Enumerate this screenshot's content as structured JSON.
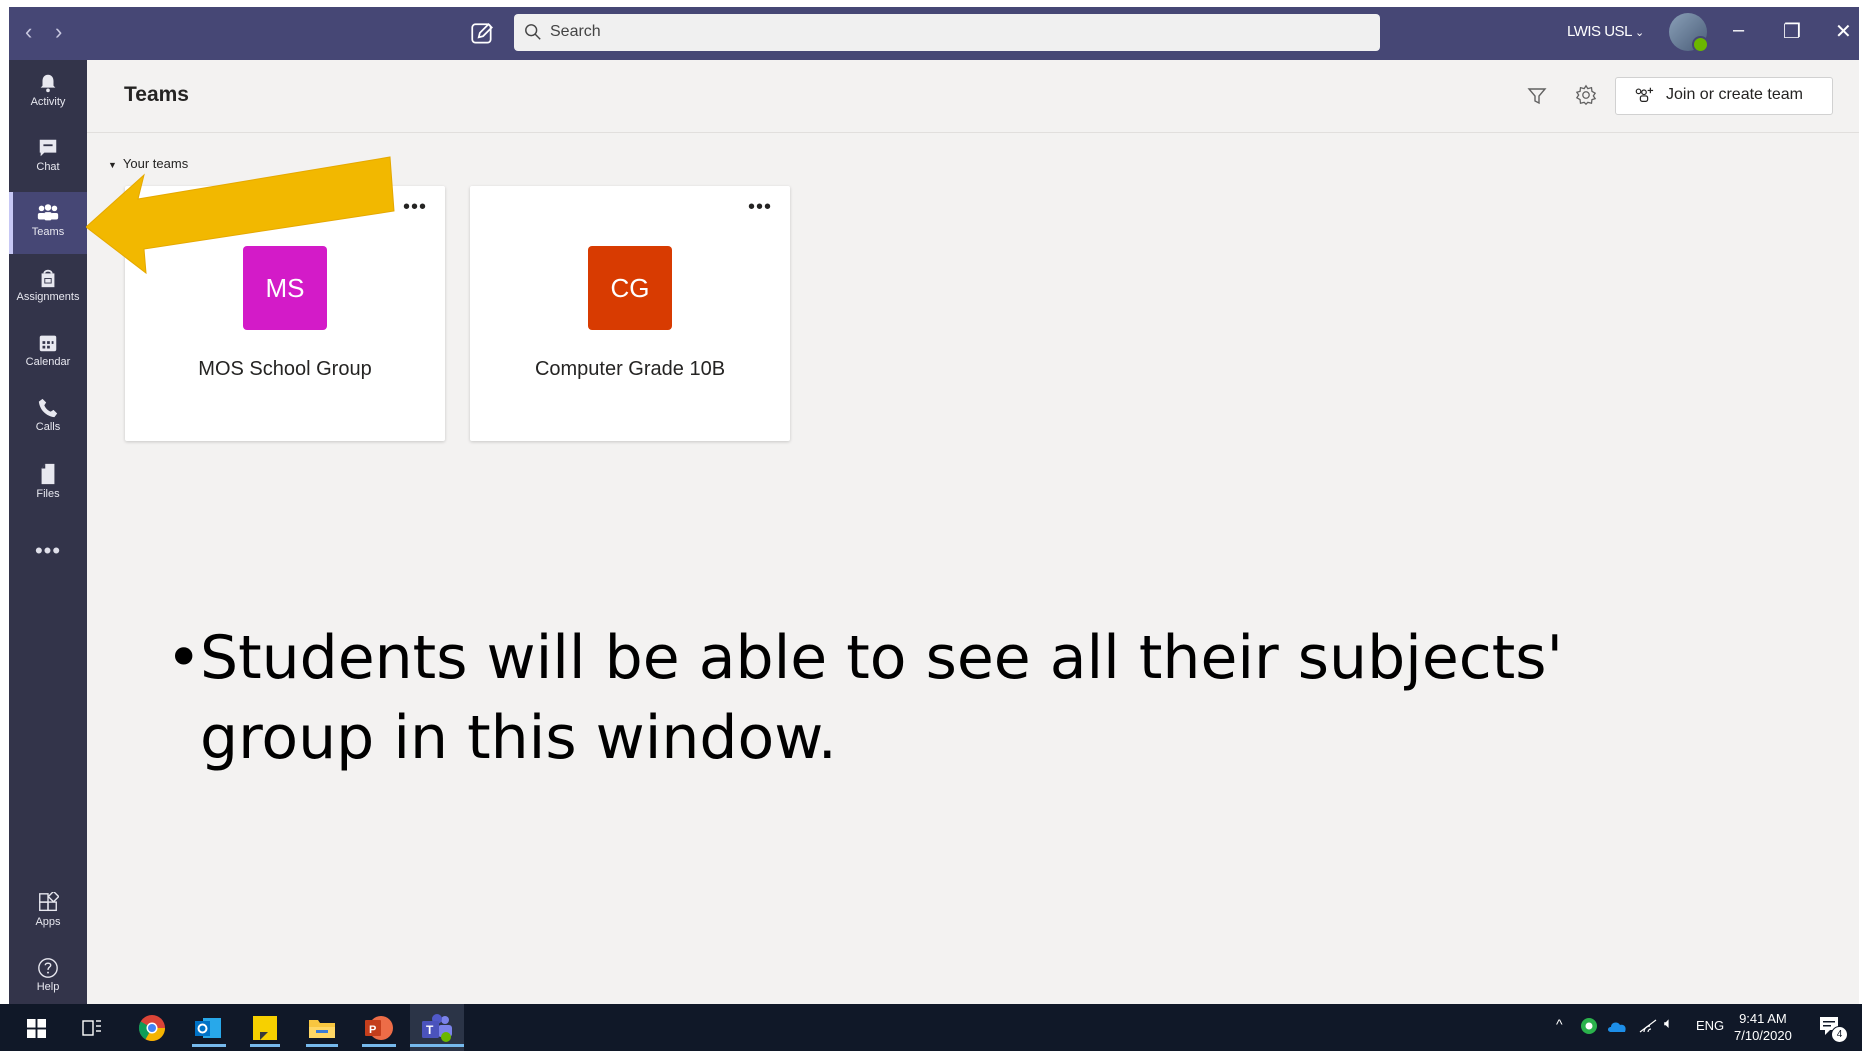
{
  "window": {
    "search_placeholder": "Search",
    "account_name": "LWIS USL",
    "minimize": "–",
    "restore": "❐",
    "close": "✕"
  },
  "rail": {
    "items": [
      {
        "label": "Activity",
        "icon": "bell-icon"
      },
      {
        "label": "Chat",
        "icon": "chat-icon"
      },
      {
        "label": "Teams",
        "icon": "teams-icon",
        "active": true
      },
      {
        "label": "Assignments",
        "icon": "assignments-icon"
      },
      {
        "label": "Calendar",
        "icon": "calendar-icon"
      },
      {
        "label": "Calls",
        "icon": "phone-icon"
      },
      {
        "label": "Files",
        "icon": "file-icon"
      }
    ],
    "more": "•••",
    "bottom": [
      {
        "label": "Apps",
        "icon": "apps-icon"
      },
      {
        "label": "Help",
        "icon": "help-icon"
      }
    ]
  },
  "header": {
    "title": "Teams",
    "join_button": "Join or create team"
  },
  "section_label": "Your teams",
  "teams": [
    {
      "initials": "MS",
      "name": "MOS School Group",
      "color": "#d31bc8"
    },
    {
      "initials": "CG",
      "name": "Computer Grade 10B",
      "color": "#d83b01"
    }
  ],
  "card_more": "•••",
  "caption": {
    "bullet": "•",
    "text": "Students will be able to see all their subjects' group in this window."
  },
  "taskbar": {
    "language": "ENG",
    "time": "9:41 AM",
    "date": "7/10/2020",
    "notification_count": "4"
  },
  "colors": {
    "titlebar": "#464775",
    "rail": "#33344a",
    "arrow": "#f2b800"
  }
}
